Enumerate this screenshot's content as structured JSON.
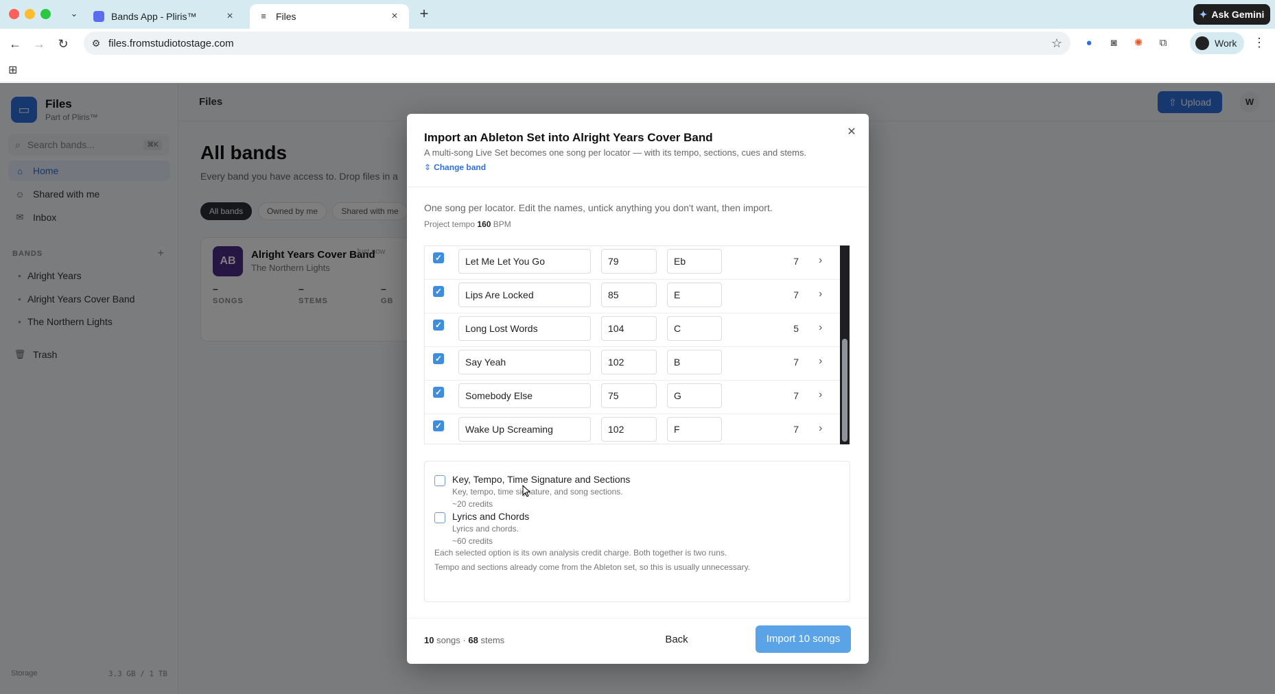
{
  "browser": {
    "tabs": [
      {
        "title": "Bands App - Pliris™",
        "icon": "bands-app-favicon"
      },
      {
        "title": "Files",
        "icon": "files-favicon"
      }
    ],
    "url": "files.fromstudiotostage.com",
    "ask_gemini": "Ask Gemini",
    "profile": "Work"
  },
  "app": {
    "name": "Files",
    "subtitle": "Part of Pliris™",
    "search_placeholder": "Search bands...",
    "search_shortcut": "⌘K",
    "nav": [
      {
        "label": "Home",
        "icon": "home-icon",
        "active": true
      },
      {
        "label": "Shared with me",
        "icon": "users-icon"
      },
      {
        "label": "Inbox",
        "icon": "inbox-icon"
      }
    ],
    "bands_heading": "BANDS",
    "bands": [
      "Alright Years",
      "Alright Years Cover Band",
      "The Northern Lights"
    ],
    "trash": "Trash",
    "storage_label": "Storage",
    "storage_value": "3.3 GB / 1 TB",
    "header_title": "Files",
    "upload": "Upload",
    "user_initial": "W",
    "page_title": "All bands",
    "page_subtitle": "Every band you have access to. Drop files in a",
    "filters": [
      "All bands",
      "Owned by me",
      "Shared with me"
    ],
    "card": {
      "initials": "AB",
      "name": "Alright Years Cover Band",
      "subtitle": "The Northern Lights",
      "time": "Just now",
      "stats": [
        {
          "value": "–",
          "label": "SONGS"
        },
        {
          "value": "–",
          "label": "STEMS"
        },
        {
          "value": "–",
          "label": "GB"
        }
      ]
    }
  },
  "modal": {
    "title": "Import an Ableton Set into Alright Years Cover Band",
    "subtitle": "A multi-song Live Set becomes one song per locator — with its tempo, sections, cues and stems.",
    "change_band": "Change band",
    "instructions": "One song per locator. Edit the names, untick anything you don't want, then import.",
    "tempo_label": "Project tempo",
    "tempo_value": "160",
    "tempo_unit": "BPM",
    "songs": [
      {
        "checked": true,
        "name": "Let Me Let You Go",
        "bpm": "79",
        "key": "Eb",
        "stems": "7"
      },
      {
        "checked": true,
        "name": "Lips Are Locked",
        "bpm": "85",
        "key": "E",
        "stems": "7"
      },
      {
        "checked": true,
        "name": "Long Lost Words",
        "bpm": "104",
        "key": "C",
        "stems": "5"
      },
      {
        "checked": true,
        "name": "Say Yeah",
        "bpm": "102",
        "key": "B",
        "stems": "7"
      },
      {
        "checked": true,
        "name": "Somebody Else",
        "bpm": "75",
        "key": "G",
        "stems": "7"
      },
      {
        "checked": true,
        "name": "Wake Up Screaming",
        "bpm": "102",
        "key": "F",
        "stems": "7"
      }
    ],
    "analysis_options": [
      {
        "checked": false,
        "title": "Key, Tempo, Time Signature and Sections",
        "description": "Key, tempo, time signature, and song sections.",
        "credits": "~20 credits"
      },
      {
        "checked": false,
        "title": "Lyrics and Chords",
        "description": "Lyrics and chords.",
        "credits": "~60 credits"
      }
    ],
    "note_charge": "Each selected option is its own analysis credit charge. Both together is two runs.",
    "note_tempo": "Tempo and sections already come from the Ableton set, so this is usually unnecessary.",
    "summary": {
      "songs": "10",
      "songs_label": "songs",
      "sep": "·",
      "stems": "68",
      "stems_label": "stems"
    },
    "back": "Back",
    "import": "Import 10 songs"
  }
}
